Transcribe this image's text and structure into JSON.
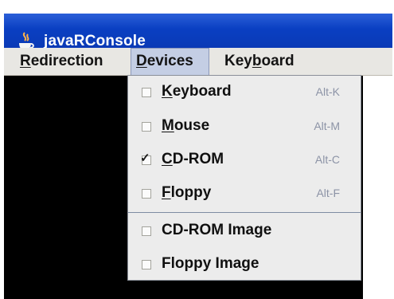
{
  "window": {
    "title": "javaRConsole"
  },
  "menubar": {
    "items": [
      {
        "label": "Redirection"
      },
      {
        "label": "Devices"
      },
      {
        "label": "Keyboard"
      }
    ]
  },
  "devices_menu": {
    "items": [
      {
        "label": "Keyboard",
        "shortcut": "Alt-K",
        "checked": false
      },
      {
        "label": "Mouse",
        "shortcut": "Alt-M",
        "checked": false
      },
      {
        "label": "CD-ROM",
        "shortcut": "Alt-C",
        "checked": true
      },
      {
        "label": "Floppy",
        "shortcut": "Alt-F",
        "checked": false
      },
      {
        "label": "CD-ROM Image",
        "shortcut": "",
        "checked": false
      },
      {
        "label": "Floppy Image",
        "shortcut": "",
        "checked": false
      }
    ],
    "checkmark_glyph": "✓"
  },
  "colors": {
    "titlebar": "#0a3fc2",
    "menubar": "#e8e7e3",
    "active_menu": "#c4cee4",
    "console": "#000000"
  }
}
